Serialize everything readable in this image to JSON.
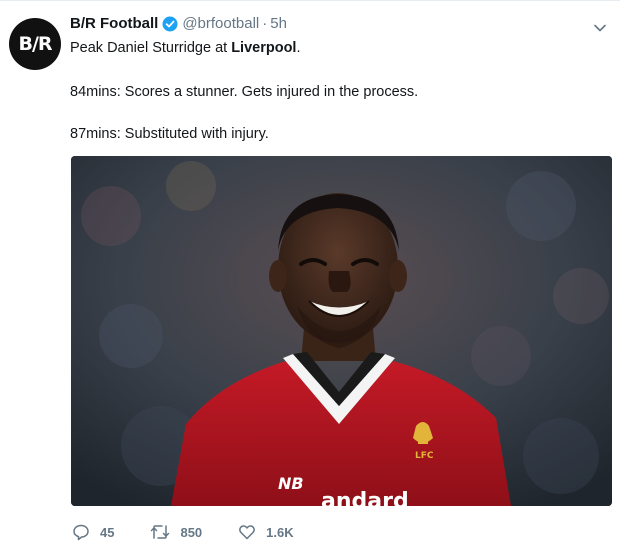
{
  "tweet": {
    "avatar_text": "B/R",
    "display_name": "B/R Football",
    "handle": "@brfootball",
    "separator": "·",
    "time": "5h",
    "text_line1_prefix": "Peak Daniel Sturridge at ",
    "text_line1_bold": "Liverpool",
    "text_line1_suffix": ".",
    "text_line2": "84mins: Scores a stunner. Gets injured in the process.",
    "text_line3": "87mins: Substituted with injury."
  },
  "media": {
    "description_icon": "photo",
    "shirt_sponsor_partial": "andard",
    "crest_text": "LFC"
  },
  "actions": {
    "reply_count": "45",
    "retweet_count": "850",
    "like_count": "1.6K"
  },
  "colors": {
    "verified_blue": "#1da1f2",
    "secondary_text": "#657786",
    "shirt_red": "#b0141f"
  }
}
